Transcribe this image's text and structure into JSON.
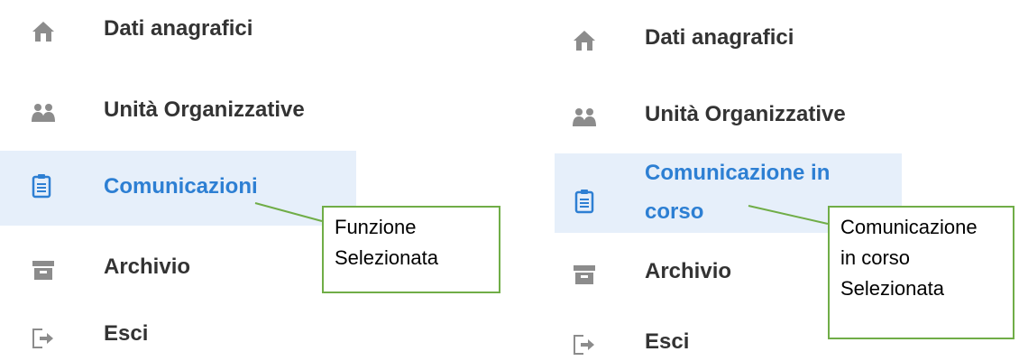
{
  "left_menu": {
    "items": [
      {
        "label": "Dati anagrafici",
        "icon": "home-icon"
      },
      {
        "label": "Unità Organizzative",
        "icon": "users-icon"
      },
      {
        "label": "Comunicazioni",
        "icon": "clipboard-icon",
        "selected": true
      },
      {
        "label": "Archivio",
        "icon": "archive-icon"
      },
      {
        "label": "Esci",
        "icon": "logout-icon"
      }
    ],
    "callout": {
      "line1": "Funzione",
      "line2": "Selezionata"
    }
  },
  "right_menu": {
    "items": [
      {
        "label": "Dati anagrafici",
        "icon": "home-icon"
      },
      {
        "label": "Unità Organizzative",
        "icon": "users-icon"
      },
      {
        "label": "Comunicazione in corso",
        "icon": "clipboard-icon",
        "selected": true
      },
      {
        "label": "Archivio",
        "icon": "archive-icon"
      },
      {
        "label": "Esci",
        "icon": "logout-icon"
      }
    ],
    "callout": {
      "line1": "Comunicazione",
      "line2": "in corso",
      "line3": "Selezionata"
    }
  },
  "colors": {
    "selected_bg": "#e6effa",
    "active_text": "#2d7fd3",
    "normal_text": "#333333",
    "icon_gray": "#8c8c8c",
    "active_icon": "#2d7fd3",
    "callout_border": "#70ad47"
  }
}
